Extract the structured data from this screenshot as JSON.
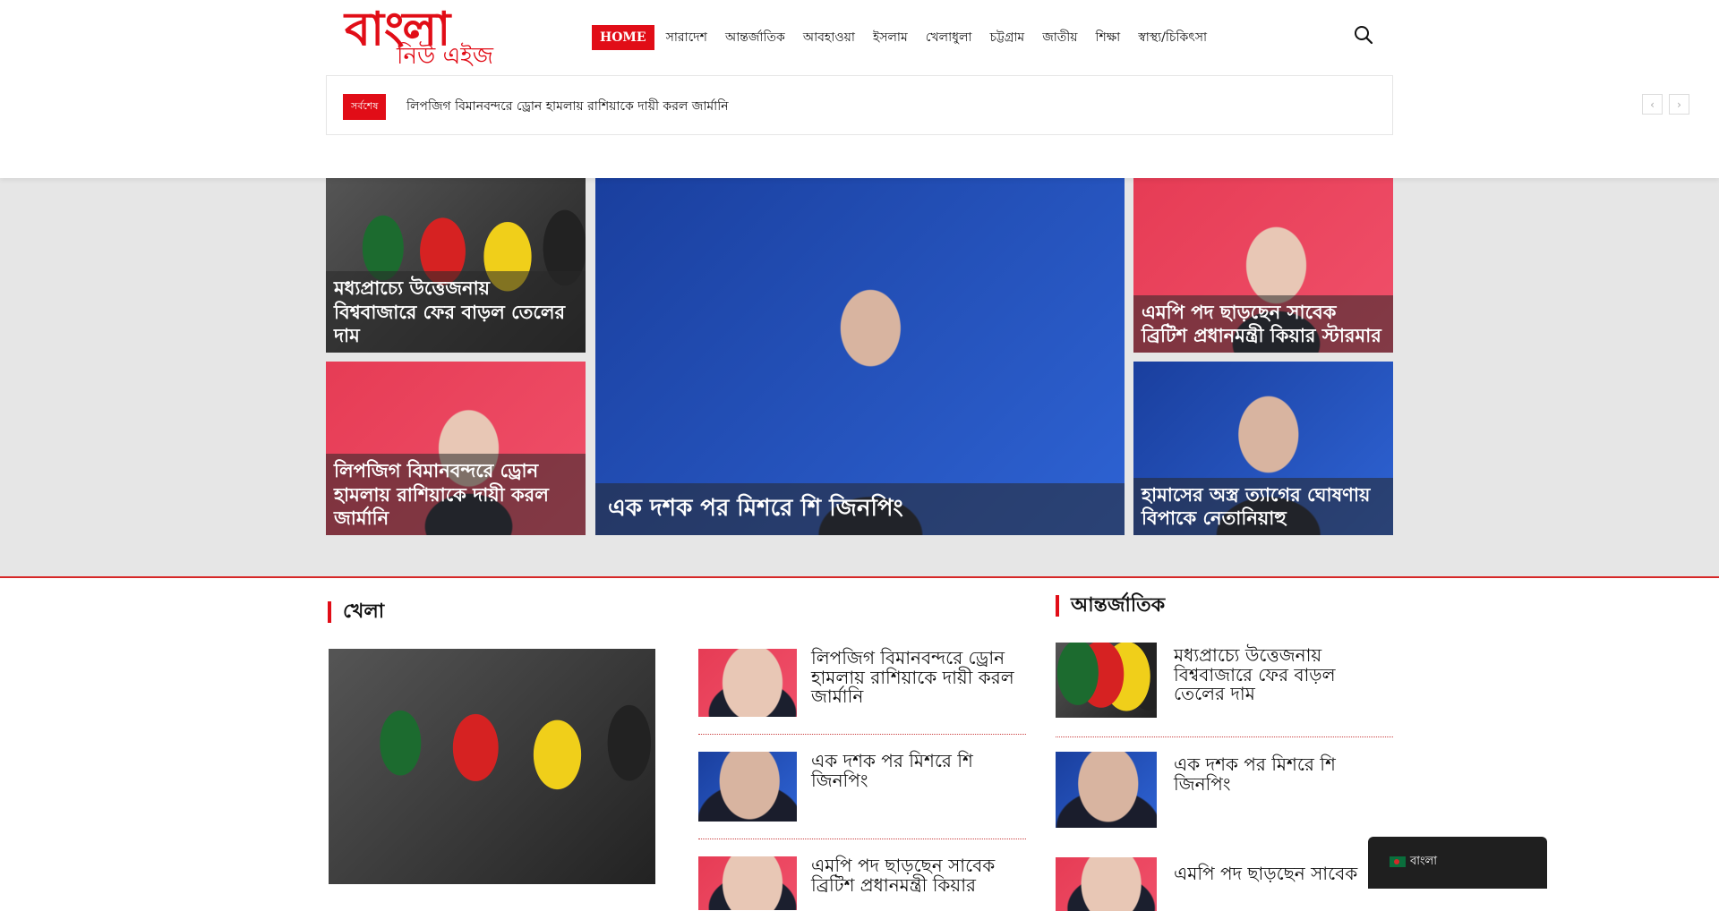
{
  "header": {
    "logo_main": "বাংলা",
    "logo_sub": "নিউ এইজ",
    "nav": [
      "HOME",
      "সারাদেশ",
      "আন্তর্জাতিক",
      "আবহাওয়া",
      "ইসলাম",
      "খেলাধুলা",
      "চট্টগ্রাম",
      "জাতীয়",
      "শিক্ষা",
      "স্বাস্থ্য/চিকিৎসা"
    ],
    "search_icon": "search-icon"
  },
  "ticker": {
    "badge": "সর্বশেষ",
    "text": "লিপজিগ বিমানবন্দরে ড্রোন হামলায় রাশিয়াকে দায়ী করল জার্মানি",
    "prev": "‹",
    "next": "›"
  },
  "featured": {
    "top_left": "মধ্যপ্রাচ্যে উত্তেজনায় বিশ্ববাজারে ফের বাড়ল তেলের দাম",
    "bottom_left": "লিপজিগ বিমানবন্দরে ড্রোন হামলায় রাশিয়াকে দায়ী করল জার্মানি",
    "center": "এক দশক পর মিশরে শি জিনপিং",
    "top_right": "এমপি পদ ছাড়ছেন সাবেক ব্রিটিশ প্রধানমন্ত্রী কিয়ার স্টারমার",
    "bottom_right": "হামাসের অস্ত্র ত্যাগের ঘোষণায় বিপাকে নেতানিয়াহু"
  },
  "sports": {
    "title": "খেলা",
    "items": [
      "লিপজিগ বিমানবন্দরে ড্রোন হামলায় রাশিয়াকে দায়ী করল জার্মানি",
      "এক দশক পর মিশরে শি জিনপিং",
      "এমপি পদ ছাড়ছেন সাবেক ব্রিটিশ প্রধানমন্ত্রী কিয়ার"
    ]
  },
  "international": {
    "title": "আন্তর্জাতিক",
    "items": [
      "মধ্যপ্রাচ্যে উত্তেজনায় বিশ্ববাজারে ফের বাড়ল তেলের দাম",
      "এক দশক পর মিশরে শি জিনপিং",
      "এমপি পদ ছাড়ছেন সাবেক"
    ]
  },
  "language": {
    "label": "বাংলা"
  },
  "colors": {
    "accent": "#e10d17",
    "featured_bg": "#e6e6e6"
  }
}
